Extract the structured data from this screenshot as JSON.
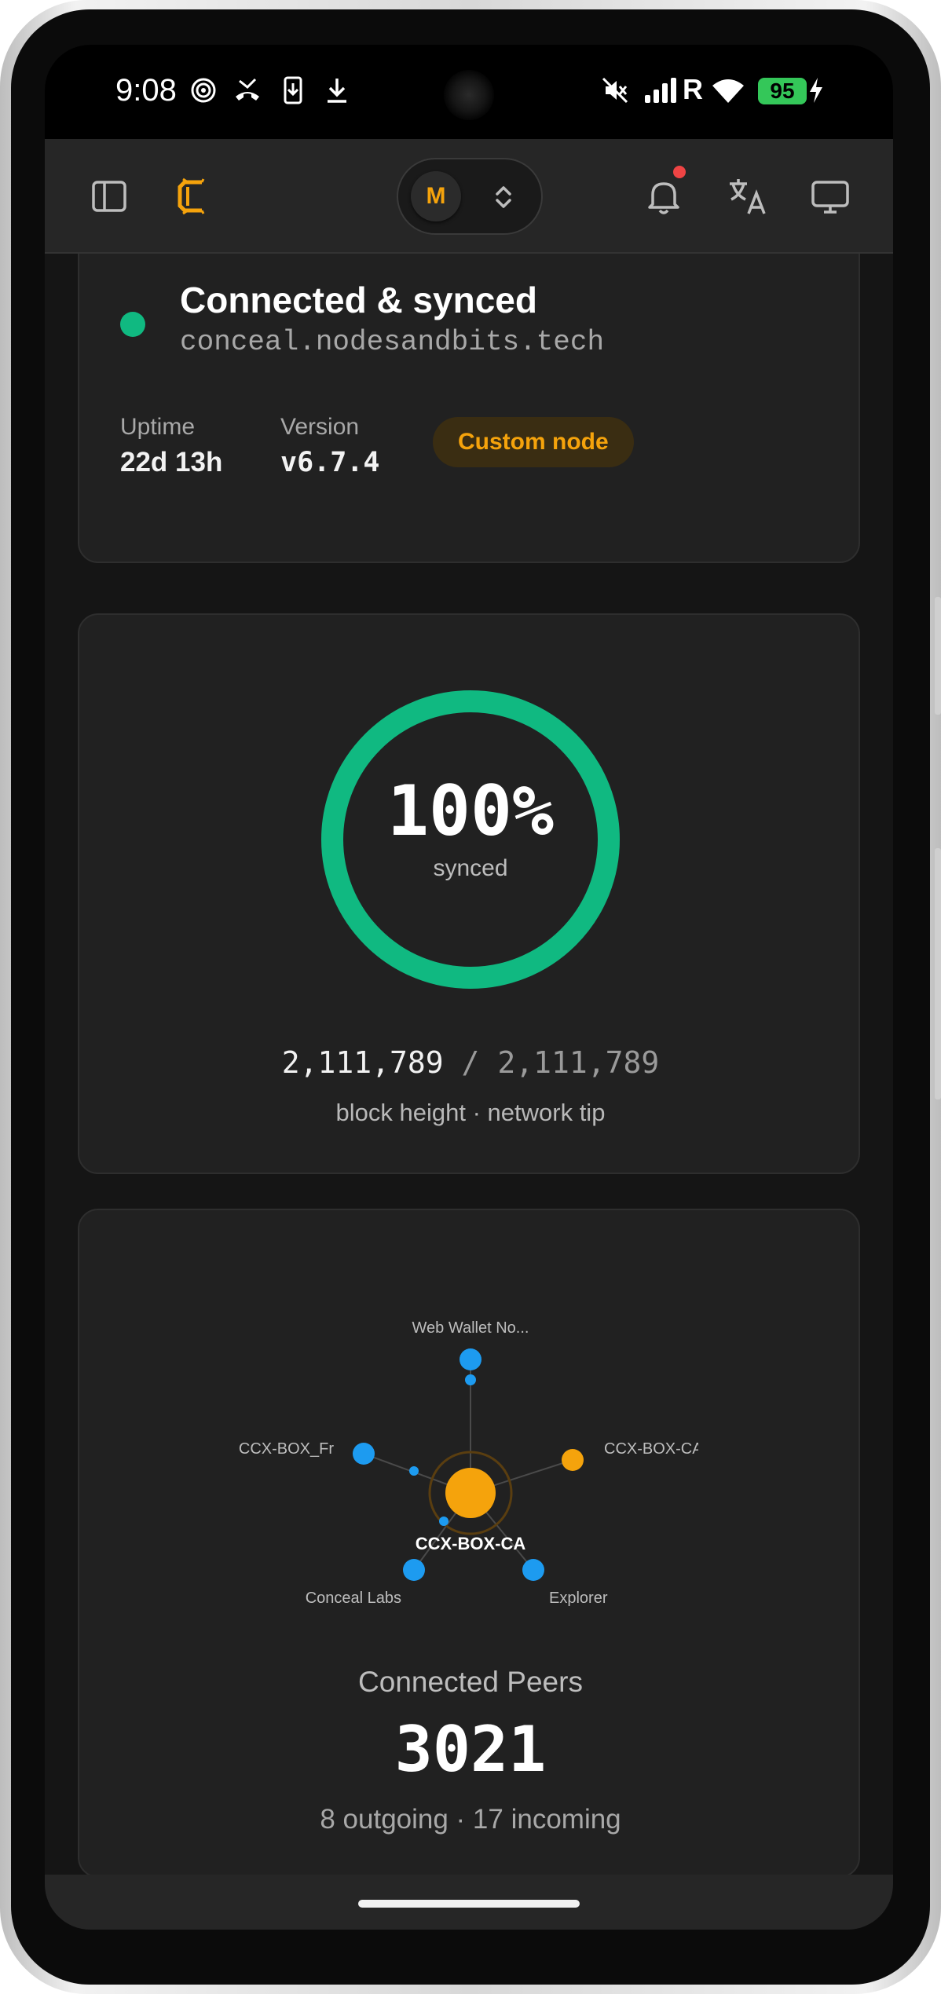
{
  "status_bar": {
    "time": "9:08",
    "battery": "95",
    "icons": [
      "tracking-icon",
      "missed-call-icon",
      "phone-download-icon",
      "download-icon",
      "mute-icon",
      "signal-icon",
      "wifi-icon",
      "charging-icon"
    ],
    "roaming": "R"
  },
  "header": {
    "account_initial": "M",
    "icons": [
      "sidebar-toggle-icon",
      "conceal-logo-icon",
      "chevron-updown-icon",
      "bell-icon",
      "translate-icon",
      "monitor-icon"
    ],
    "accent": "#f5a30c",
    "has_notification": true
  },
  "connection": {
    "title": "Connected & synced",
    "host": "conceal.nodesandbits.tech",
    "uptime_label": "Uptime",
    "uptime_value": "22d 13h",
    "version_label": "Version",
    "version_value": "v6.7.4",
    "badge": "Custom node",
    "status_color": "#10b981"
  },
  "sync": {
    "percent": "100%",
    "progress": 1.0,
    "label": "synced",
    "block_height": "2,111,789",
    "separator": "/",
    "network_tip": "2,111,789",
    "caption": "block height · network tip",
    "ring_color": "#10b981"
  },
  "peers": {
    "center": "CCX-BOX-CA",
    "nodes": [
      {
        "label": "Web Wallet No...",
        "color": "#1d9bf0"
      },
      {
        "label": "CCX-BOX-CA",
        "color": "#f5a30c"
      },
      {
        "label": "Explorer",
        "color": "#1d9bf0"
      },
      {
        "label": "Conceal Labs",
        "color": "#1d9bf0"
      },
      {
        "label": "CCX-BOX_Fr",
        "color": "#1d9bf0"
      }
    ],
    "title": "Connected Peers",
    "count": "3021",
    "detail": "8 outgoing · 17 incoming"
  }
}
